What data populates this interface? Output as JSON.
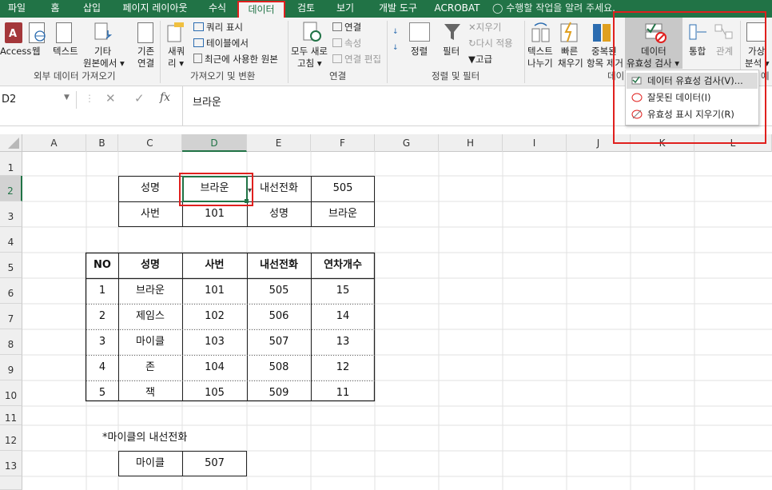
{
  "ribbon_tabs": [
    "파일",
    "홈",
    "삽입",
    "페이지 레이아웃",
    "수식",
    "데이터",
    "검토",
    "보기",
    "개발 도구",
    "ACROBAT"
  ],
  "tell_me": "수행할 작업을 알려 주세요.",
  "ribbon": {
    "access": "Access",
    "web": "웹",
    "text": "텍스트",
    "other_line1": "기타",
    "other_line2": "원본에서 ▾",
    "existing_line1": "기존",
    "existing_line2": "연결",
    "new_query_line1": "새쿼",
    "new_query_line2": "리 ▾",
    "show_queries": "쿼리 표시",
    "from_table": "테이블에서",
    "recent_sources": "최근에 사용한 원본",
    "refresh_all_line1": "모두 새로",
    "refresh_all_line2": "고침 ▾",
    "connections": "연결",
    "properties": "속성",
    "edit_links": "연결 편집",
    "sort": "정렬",
    "filter": "필터",
    "clear": "지우기",
    "reapply": "다시 적용",
    "advanced": "고급",
    "text_to_columns_line1": "텍스트",
    "text_to_columns_line2": "나누기",
    "flash_fill_line1": "빠른",
    "flash_fill_line2": "채우기",
    "remove_duplicates_line1": "중복된",
    "remove_duplicates_line2": "항목 제거",
    "data_validation_line1": "데이터",
    "data_validation_line2": "유효성 검사 ▾",
    "consolidate": "통합",
    "relationships": "관계",
    "whatif_line1": "가상",
    "whatif_line2": "분석 ▾",
    "group_get_external": "외부 데이터 가져오기",
    "group_get_transform": "가져오기 및 변환",
    "group_connections": "연결",
    "group_sort_filter": "정렬 및 필터",
    "group_data_tools_partial": "데이",
    "group_forecast_partial": "예"
  },
  "dropdown_items": [
    "데이터 유효성 검사(V)...",
    "잘못된 데이터(I)",
    "유효성 표시 지우기(R)"
  ],
  "name_box": "D2",
  "formula_value": "브라운",
  "fx_label": "fx",
  "columns": [
    "A",
    "B",
    "C",
    "D",
    "E",
    "F",
    "G",
    "H",
    "I",
    "J",
    "K",
    "L"
  ],
  "rows": [
    "1",
    "2",
    "3",
    "4",
    "5",
    "6",
    "7",
    "8",
    "9",
    "10",
    "11",
    "12",
    "13"
  ],
  "lookup_box": {
    "row2": [
      "성명",
      "브라운",
      "내선전화",
      "505"
    ],
    "row3": [
      "사번",
      "101",
      "성명",
      "브라운"
    ]
  },
  "table": {
    "headers": [
      "NO",
      "성명",
      "사번",
      "내선전화",
      "연차개수"
    ],
    "rows": [
      [
        "1",
        "브라운",
        "101",
        "505",
        "15"
      ],
      [
        "2",
        "제임스",
        "102",
        "506",
        "14"
      ],
      [
        "3",
        "마이클",
        "103",
        "507",
        "13"
      ],
      [
        "4",
        "존",
        "104",
        "508",
        "12"
      ],
      [
        "5",
        "잭",
        "105",
        "509",
        "11"
      ]
    ]
  },
  "note": "*마이클의 내선전화",
  "answer": [
    "마이클",
    "507"
  ],
  "colors": {
    "excel_green": "#217346",
    "highlight_red": "#e0201e"
  }
}
